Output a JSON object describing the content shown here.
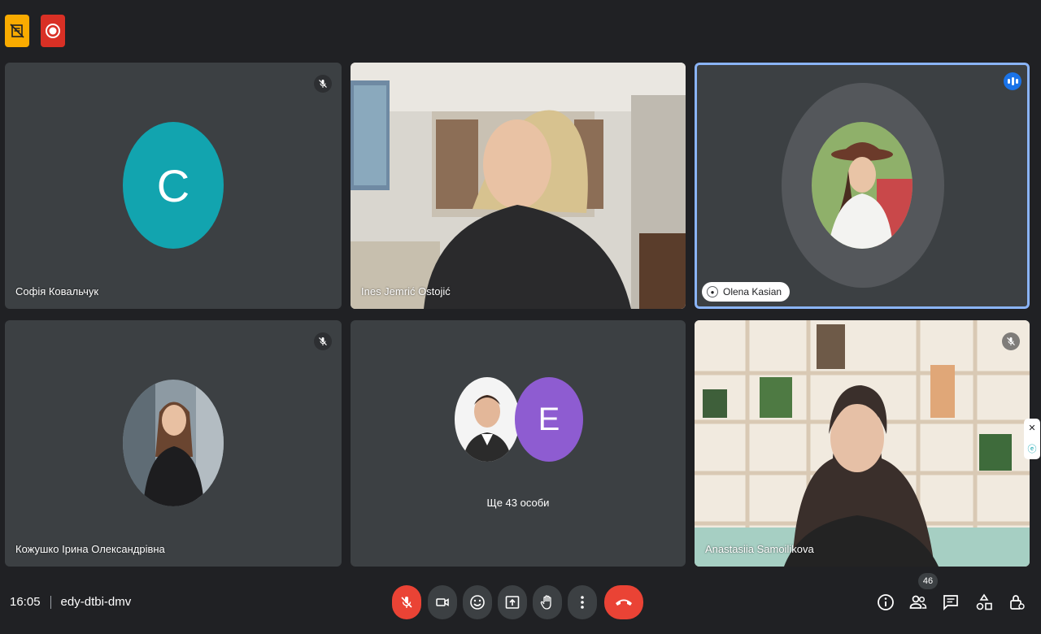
{
  "participants": [
    {
      "name": "Софія Ковальчук",
      "initial": "C",
      "avatar_color": "#12a4af",
      "muted": true
    },
    {
      "name": "Ines Jemrić Ostojić",
      "muted": false
    },
    {
      "name": "Olena Kasian",
      "muted": false,
      "speaking": true
    },
    {
      "name": "Кожушко Ірина Олександрівна",
      "muted": true
    },
    {
      "group_label": "Ще 43 особи",
      "initial": "E",
      "avatar_color": "#8e5cd1"
    },
    {
      "name": "Anastasiia Samoilikova",
      "muted": true
    }
  ],
  "meeting": {
    "time": "16:05",
    "code": "edy-dtbi-dmv",
    "participant_count": "46"
  },
  "icons": {
    "mic": "mic-off-icon",
    "camera": "camera-icon",
    "emoji": "emoji-icon",
    "present": "present-icon",
    "hand": "raise-hand-icon",
    "more": "more-vert-icon",
    "hangup": "call-end-icon",
    "info": "info-icon",
    "people": "people-icon",
    "chat": "chat-icon",
    "activities": "activities-icon",
    "host": "host-controls-icon"
  },
  "colors": {
    "speaking_border": "#8ab4f8",
    "hangup": "#ea4335",
    "background": "#202124",
    "tile": "#3c4043"
  }
}
